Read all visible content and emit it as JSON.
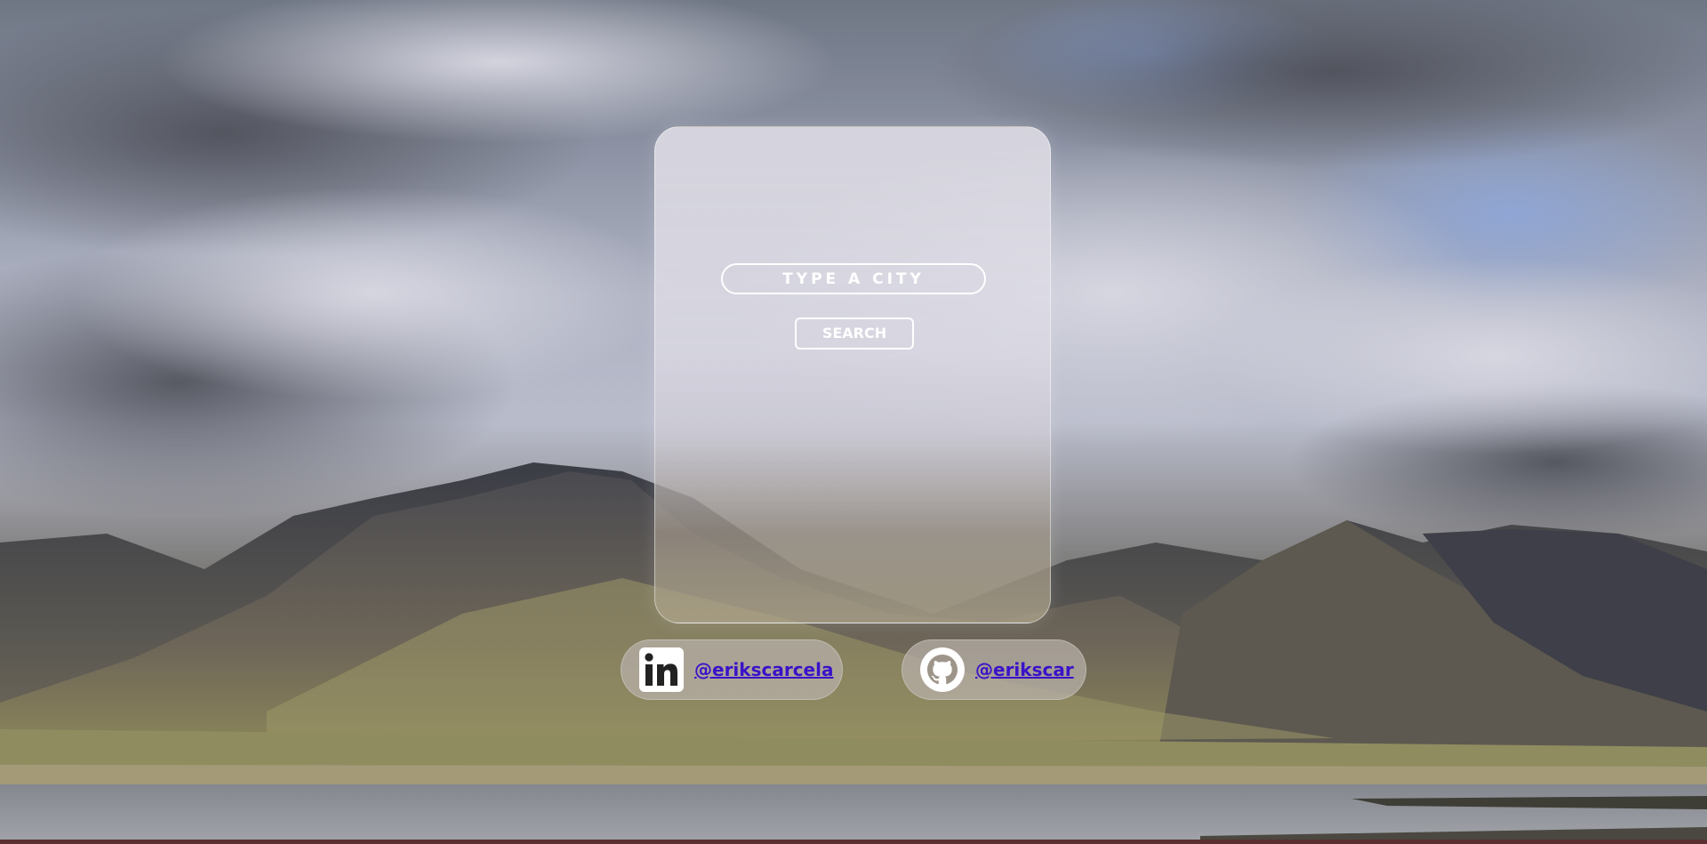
{
  "search": {
    "placeholder": "TYPE A CITY",
    "button_label": "SEARCH"
  },
  "social": {
    "linkedin": {
      "icon": "linkedin-icon",
      "handle": "@erikscarcela"
    },
    "github": {
      "icon": "github-icon",
      "handle": "@erikscar"
    }
  },
  "colors": {
    "link": "#3a12c9",
    "input_border": "#ffffff"
  }
}
